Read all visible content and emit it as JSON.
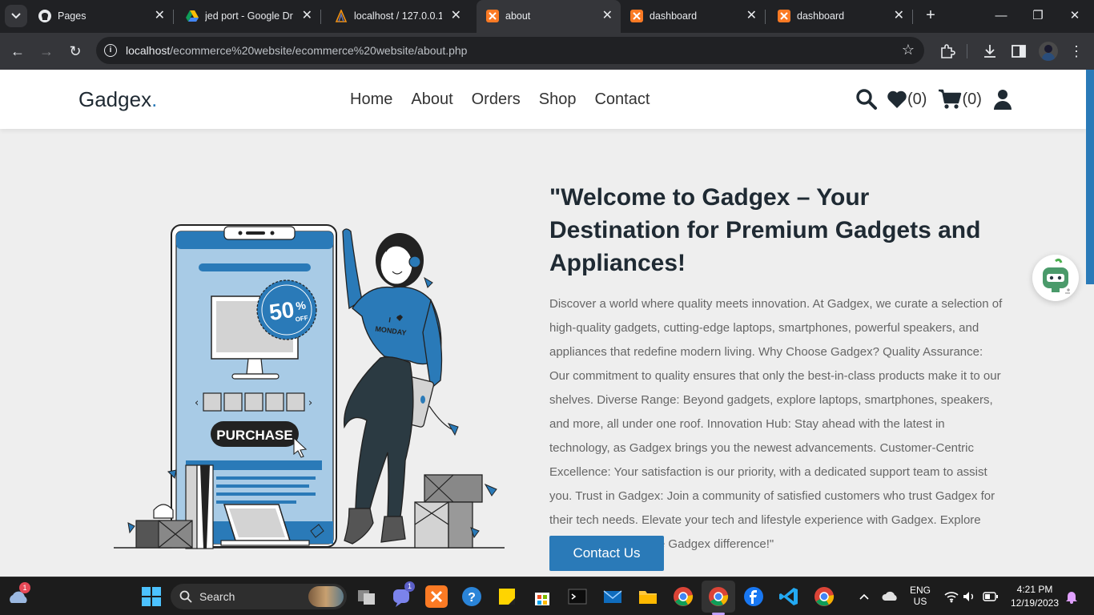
{
  "browser": {
    "tabs": [
      {
        "title": "Pages",
        "icon": "github-icon"
      },
      {
        "title": "jed port - Google Dri",
        "icon": "google-drive-icon"
      },
      {
        "title": "localhost / 127.0.0.1 /",
        "icon": "phpmyadmin-icon"
      },
      {
        "title": "about",
        "icon": "xampp-icon",
        "active": true
      },
      {
        "title": "dashboard",
        "icon": "xampp-icon"
      },
      {
        "title": "dashboard",
        "icon": "xampp-icon"
      }
    ],
    "url_host": "localhost",
    "url_path": "/ecommerce%20website/ecommerce%20website/about.php"
  },
  "site": {
    "logo_text": "Gadgex",
    "logo_dot": ".",
    "nav": [
      "Home",
      "About",
      "Orders",
      "Shop",
      "Contact"
    ],
    "wishlist_count": "(0)",
    "cart_count": "(0)",
    "accent": "#2a7ab8"
  },
  "about": {
    "heading": "\"Welcome to Gadgex – Your Destination for Premium Gadgets and Appliances!",
    "body": "Discover a world where quality meets innovation. At Gadgex, we curate a selection of high-quality gadgets, cutting-edge laptops, smartphones, powerful speakers, and appliances that redefine modern living. Why Choose Gadgex? Quality Assurance: Our commitment to quality ensures that only the best-in-class products make it to our shelves. Diverse Range: Beyond gadgets, explore laptops, smartphones, speakers, and more, all under one roof. Innovation Hub: Stay ahead with the latest in technology, as Gadgex brings you the newest advancements. Customer-Centric Excellence: Your satisfaction is our priority, with a dedicated support team to assist you. Trust in Gadgex: Join a community of satisfied customers who trust Gadgex for their tech needs. Elevate your tech and lifestyle experience with Gadgex. Explore now and embrace the Gadgex difference!\"",
    "cta_label": "Contact Us",
    "illustration": {
      "badge_value": "50",
      "badge_percent": "%",
      "badge_off": "OFF",
      "purchase_label": "PURCHASE",
      "shirt_text_1": "I",
      "shirt_text_2": "MONDAY"
    }
  },
  "taskbar": {
    "search_label": "Search",
    "weather_badge": "1",
    "teams_badge": "1",
    "lang_line1": "ENG",
    "lang_line2": "US",
    "time": "4:21 PM",
    "date": "12/19/2023"
  }
}
